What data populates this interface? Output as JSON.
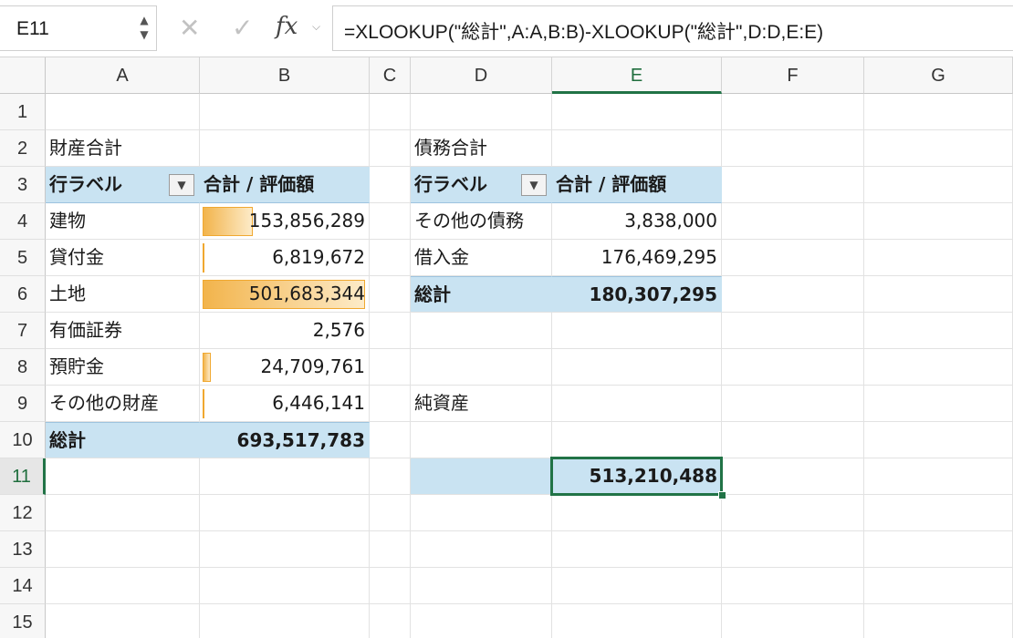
{
  "formula_bar": {
    "name_box": "E11",
    "stepper_up": "▲",
    "stepper_down": "▼",
    "cancel": "✕",
    "enter": "✓",
    "fx": "fx",
    "fx_caret": "⌵",
    "formula": "=XLOOKUP(\"総計\",A:A,B:B)-XLOOKUP(\"総計\",D:D,E:E)"
  },
  "columns": [
    "A",
    "B",
    "C",
    "D",
    "E",
    "F",
    "G"
  ],
  "active_column": "E",
  "rows": [
    "1",
    "2",
    "3",
    "4",
    "5",
    "6",
    "7",
    "8",
    "9",
    "10",
    "11",
    "12",
    "13",
    "14",
    "15"
  ],
  "active_row": "11",
  "pivot_assets": {
    "title": "財産合計",
    "header_label": "行ラベル",
    "header_value": "合計 / 評価額",
    "filter_icon": "▼",
    "items": [
      {
        "label": "建物",
        "value": "153,856,289",
        "bar_fraction": 0.307
      },
      {
        "label": "貸付金",
        "value": "6,819,672",
        "bar_fraction": 0.014
      },
      {
        "label": "土地",
        "value": "501,683,344",
        "bar_fraction": 1.0
      },
      {
        "label": "有価証券",
        "value": "2,576",
        "bar_fraction": 0.0
      },
      {
        "label": "預貯金",
        "value": "24,709,761",
        "bar_fraction": 0.049
      },
      {
        "label": "その他の財産",
        "value": "6,446,141",
        "bar_fraction": 0.013
      }
    ],
    "total_label": "総計",
    "total_value": "693,517,783"
  },
  "pivot_debts": {
    "title": "債務合計",
    "header_label": "行ラベル",
    "header_value": "合計 / 評価額",
    "filter_icon": "▼",
    "items": [
      {
        "label": "その他の債務",
        "value": "3,838,000"
      },
      {
        "label": "借入金",
        "value": "176,469,295"
      }
    ],
    "total_label": "総計",
    "total_value": "180,307,295"
  },
  "net_assets": {
    "label": "純資産",
    "value": "513,210,488"
  },
  "colors": {
    "pivot_fill": "#c9e3f2",
    "selection": "#217346",
    "databar": "#f2b44c"
  }
}
